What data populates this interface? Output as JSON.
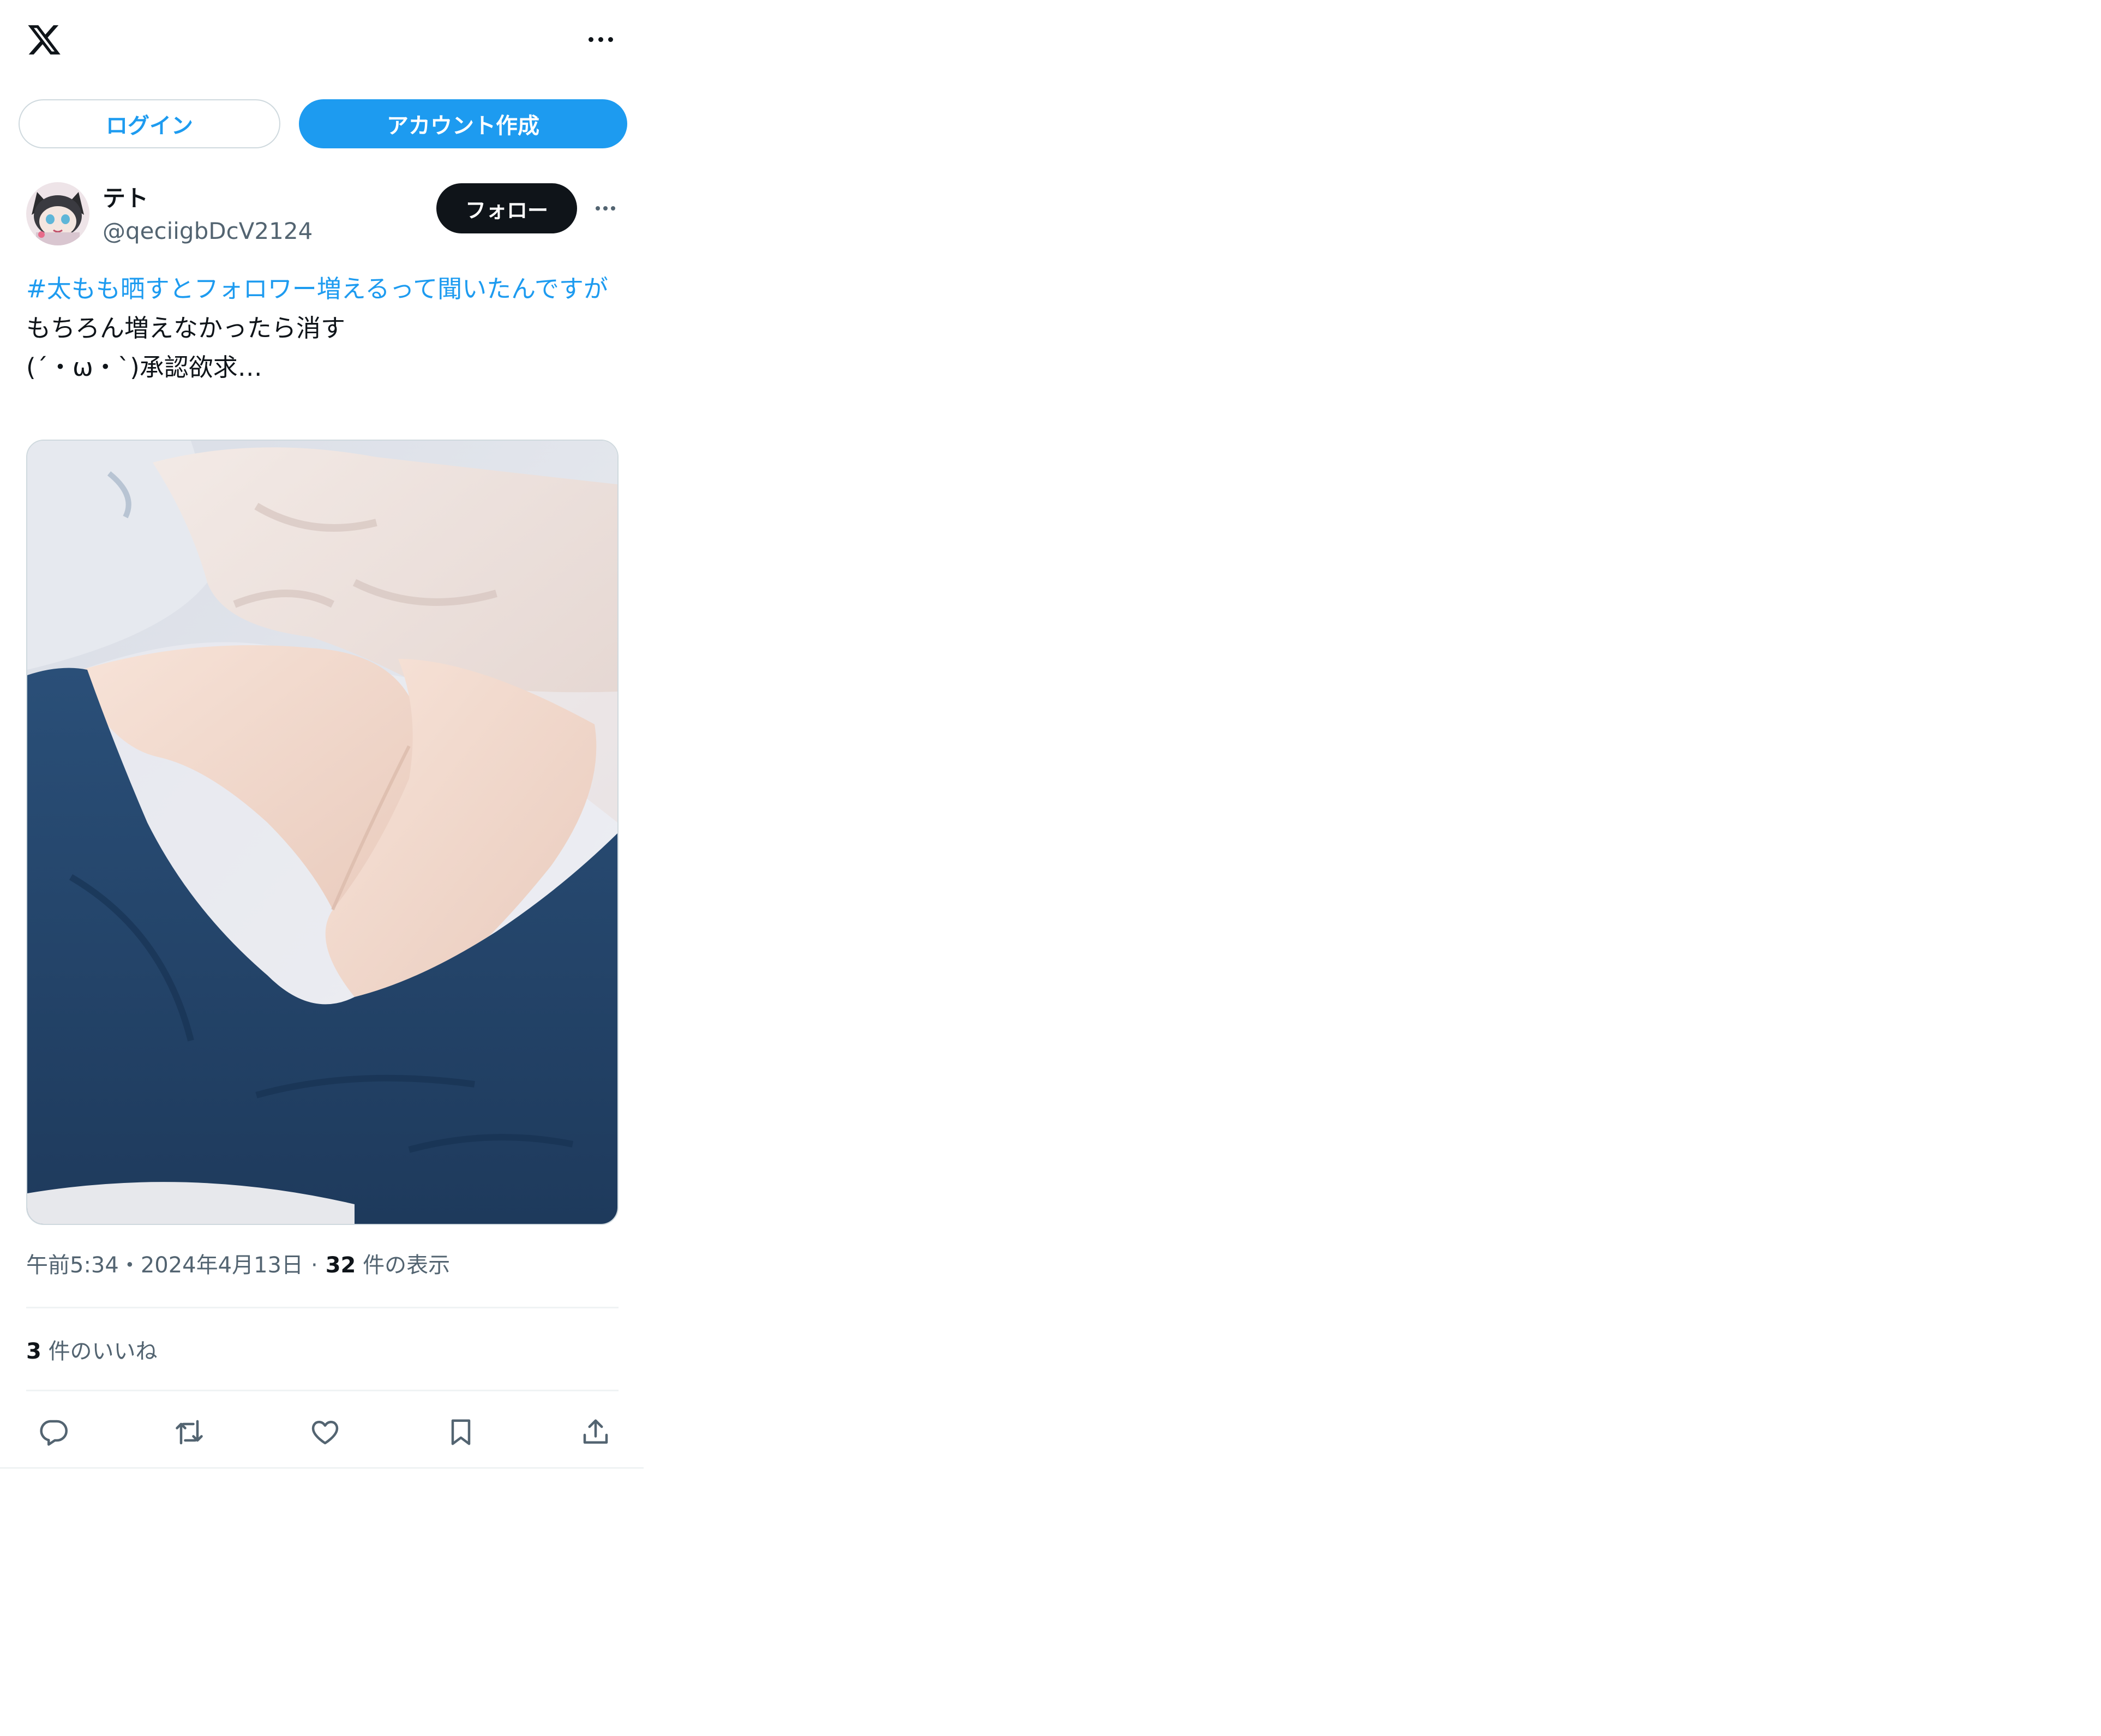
{
  "header": {
    "logo": "x-logo-icon",
    "more_icon": "ellipsis-icon"
  },
  "auth": {
    "login_label": "ログイン",
    "signup_label": "アカウント作成"
  },
  "tweet": {
    "author": {
      "display_name": "テト",
      "handle": "@qeciigbDcV2124",
      "avatar": "anime-avatar"
    },
    "follow_label": "フォロー",
    "more_icon": "ellipsis-icon",
    "text": {
      "hashtag": "#太もも晒すとフォロワー増えるって聞いたんですが",
      "line2": "もちろん増えなかったら消す",
      "line3": "(´・ω・`)承認欲求…"
    },
    "media": {
      "description_icon": "photo-legs-on-bed"
    },
    "meta": {
      "timestamp": "午前5:34・2024年4月13日",
      "separator": "·",
      "views_count": "32",
      "views_label": "件の表示"
    },
    "likes": {
      "count": "3",
      "label": "件のいいね"
    },
    "actions": [
      "reply-icon",
      "retweet-icon",
      "like-icon",
      "bookmark-icon",
      "share-icon"
    ]
  },
  "colors": {
    "accent": "#1d9bf0",
    "text": "#0f1419",
    "muted": "#536471",
    "border": "#cfd9de"
  }
}
